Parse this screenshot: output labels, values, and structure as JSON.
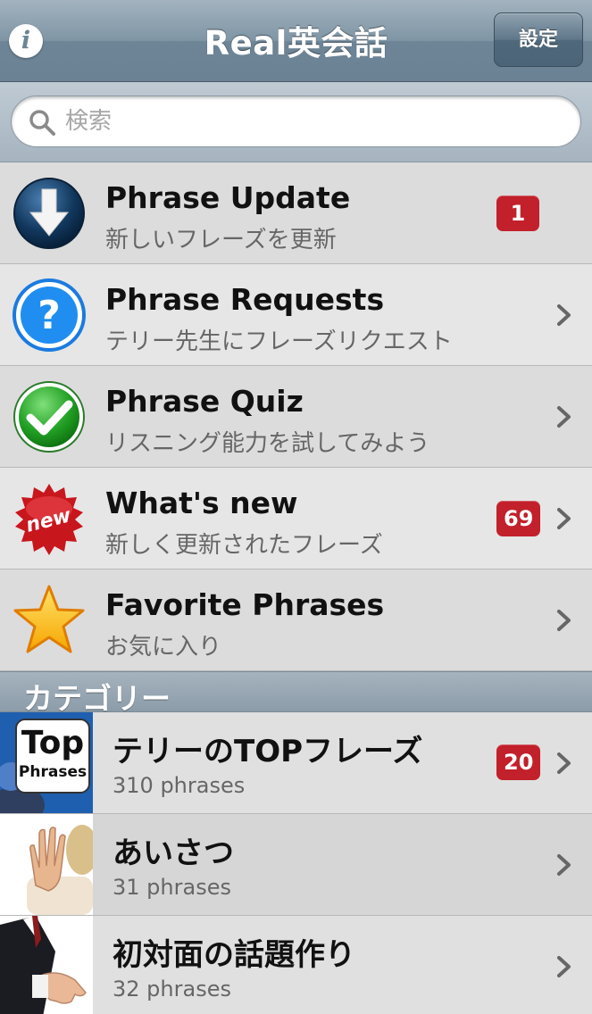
{
  "navbar": {
    "title": "Real英会話",
    "info_icon": "i",
    "settings_label": "設定"
  },
  "search": {
    "placeholder": "検索",
    "value": ""
  },
  "menu": [
    {
      "title": "Phrase Update",
      "subtitle": "新しいフレーズを更新",
      "badge": "1",
      "icon": "download-arrow-icon",
      "chevron": false
    },
    {
      "title": "Phrase Requests",
      "subtitle": "テリー先生にフレーズリクエスト",
      "badge": "",
      "icon": "question-icon",
      "chevron": true
    },
    {
      "title": "Phrase Quiz",
      "subtitle": "リスニング能力を試してみよう",
      "badge": "",
      "icon": "checkmark-icon",
      "chevron": true
    },
    {
      "title": "What's new",
      "subtitle": "新しく更新されたフレーズ",
      "badge": "69",
      "icon": "new-burst-icon",
      "new_label": "new",
      "chevron": true
    },
    {
      "title": "Favorite Phrases",
      "subtitle": "お気に入り",
      "badge": "",
      "icon": "star-icon",
      "chevron": true
    }
  ],
  "categories_header": "カテゴリー",
  "categories": [
    {
      "title": "テリーのTOPフレーズ",
      "subtitle": "310 phrases",
      "badge": "20",
      "thumb_line1": "Top",
      "thumb_line2": "Phrases"
    },
    {
      "title": "あいさつ",
      "subtitle": "31 phrases",
      "badge": ""
    },
    {
      "title": "初対面の話題作り",
      "subtitle": "32 phrases",
      "badge": ""
    }
  ],
  "colors": {
    "badge": "#c2202b",
    "navbar": "#7f95a5",
    "row": "#dcdcdc"
  }
}
